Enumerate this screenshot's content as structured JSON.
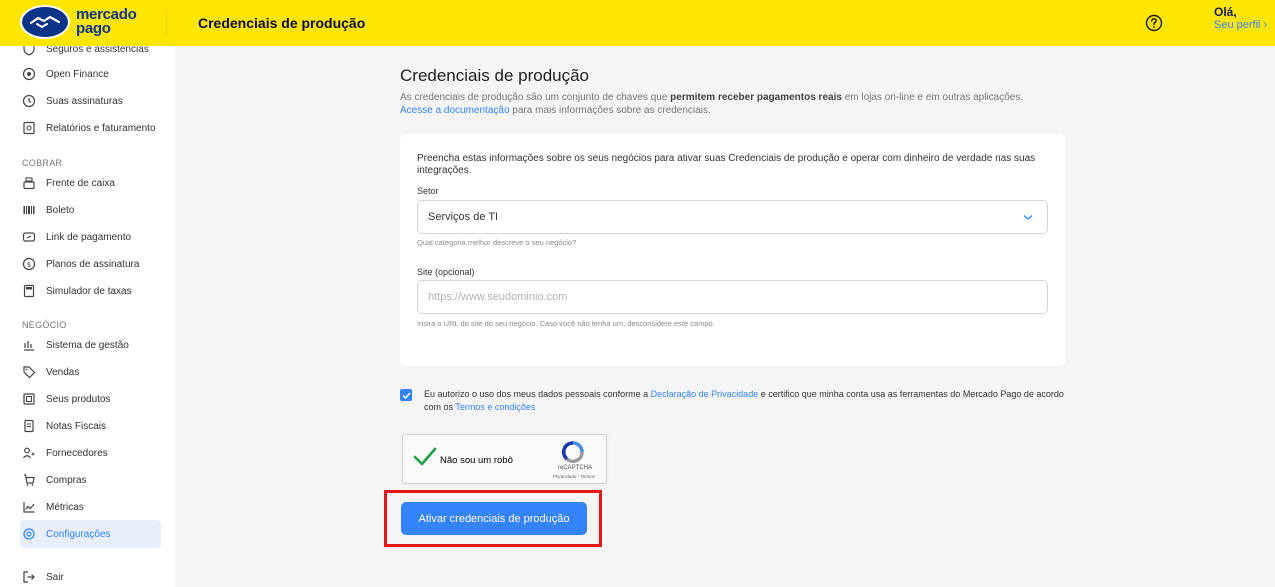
{
  "header": {
    "logo_line1": "mercado",
    "logo_line2": "pago",
    "title": "Credenciais de produção",
    "greeting": "Olá,",
    "profile_link": "Seu perfil"
  },
  "sidebar": {
    "items_top": [
      {
        "label": "Seguros e assistências",
        "icon": "shield-icon"
      },
      {
        "label": "Open Finance",
        "icon": "open-finance-icon"
      },
      {
        "label": "Suas assinaturas",
        "icon": "subscription-icon"
      },
      {
        "label": "Relatórios e faturamento",
        "icon": "report-icon"
      }
    ],
    "section_cobrar": "COBRAR",
    "items_cobrar": [
      {
        "label": "Frente de caixa",
        "icon": "cash-register-icon"
      },
      {
        "label": "Boleto",
        "icon": "barcode-icon"
      },
      {
        "label": "Link de pagamento",
        "icon": "link-icon"
      },
      {
        "label": "Planos de assinatura",
        "icon": "dollar-circle-icon"
      },
      {
        "label": "Simulador de taxas",
        "icon": "calculator-icon"
      }
    ],
    "section_negocio": "NEGÓCIO",
    "items_negocio": [
      {
        "label": "Sistema de gestão",
        "icon": "management-icon"
      },
      {
        "label": "Vendas",
        "icon": "tag-icon"
      },
      {
        "label": "Seus produtos",
        "icon": "product-box-icon"
      },
      {
        "label": "Notas Fiscais",
        "icon": "invoice-icon"
      },
      {
        "label": "Fornecedores",
        "icon": "suppliers-icon"
      },
      {
        "label": "Compras",
        "icon": "purchases-icon"
      },
      {
        "label": "Métricas",
        "icon": "metrics-chart-icon"
      },
      {
        "label": "Configurações",
        "icon": "gear-icon",
        "active": true
      }
    ],
    "logout": {
      "label": "Sair",
      "icon": "logout-icon"
    }
  },
  "main": {
    "title": "Credenciais de produção",
    "desc_pre": "As credenciais de produção são um conjunto de chaves que ",
    "desc_bold": "permitem receber pagamentos reais",
    "desc_post": " em lojas on-line e em outras aplicações.",
    "doc_link": "Acesse a documentação",
    "doc_post": " para mais informações sobre as credenciais.",
    "form": {
      "intro": "Preencha estas informações sobre os seus negócios para ativar suas Credenciais de produção e operar com dinheiro de verdade nas suas integrações.",
      "sector_label": "Setor",
      "sector_value": "Serviços de TI",
      "sector_helper": "Qual categoria melhor descreve o seu negócio?",
      "site_label": "Site (opcional)",
      "site_placeholder": "https://www.seudominio.com",
      "site_helper": "Insira o URL do site do seu negócio. Caso você não tenha um, desconsidere este campo."
    },
    "consent": {
      "text_pre": "Eu autorizo o uso dos meus dados pessoais conforme a ",
      "privacy_link": "Declaração de Privacidade",
      "text_mid": " e certifico que minha conta usa as ferramentas do Mercado Pago de acordo com os ",
      "terms_link": "Termos e condições"
    },
    "recaptcha": {
      "label": "Não sou um robô",
      "brand": "reCAPTCHA",
      "links": "Privacidade - Termos"
    },
    "submit_label": "Ativar credenciais de produção"
  },
  "colors": {
    "brand_yellow": "#ffe600",
    "brand_navy": "#0a3487",
    "accent_blue": "#3483fa",
    "highlight_red": "#e21a1a"
  }
}
